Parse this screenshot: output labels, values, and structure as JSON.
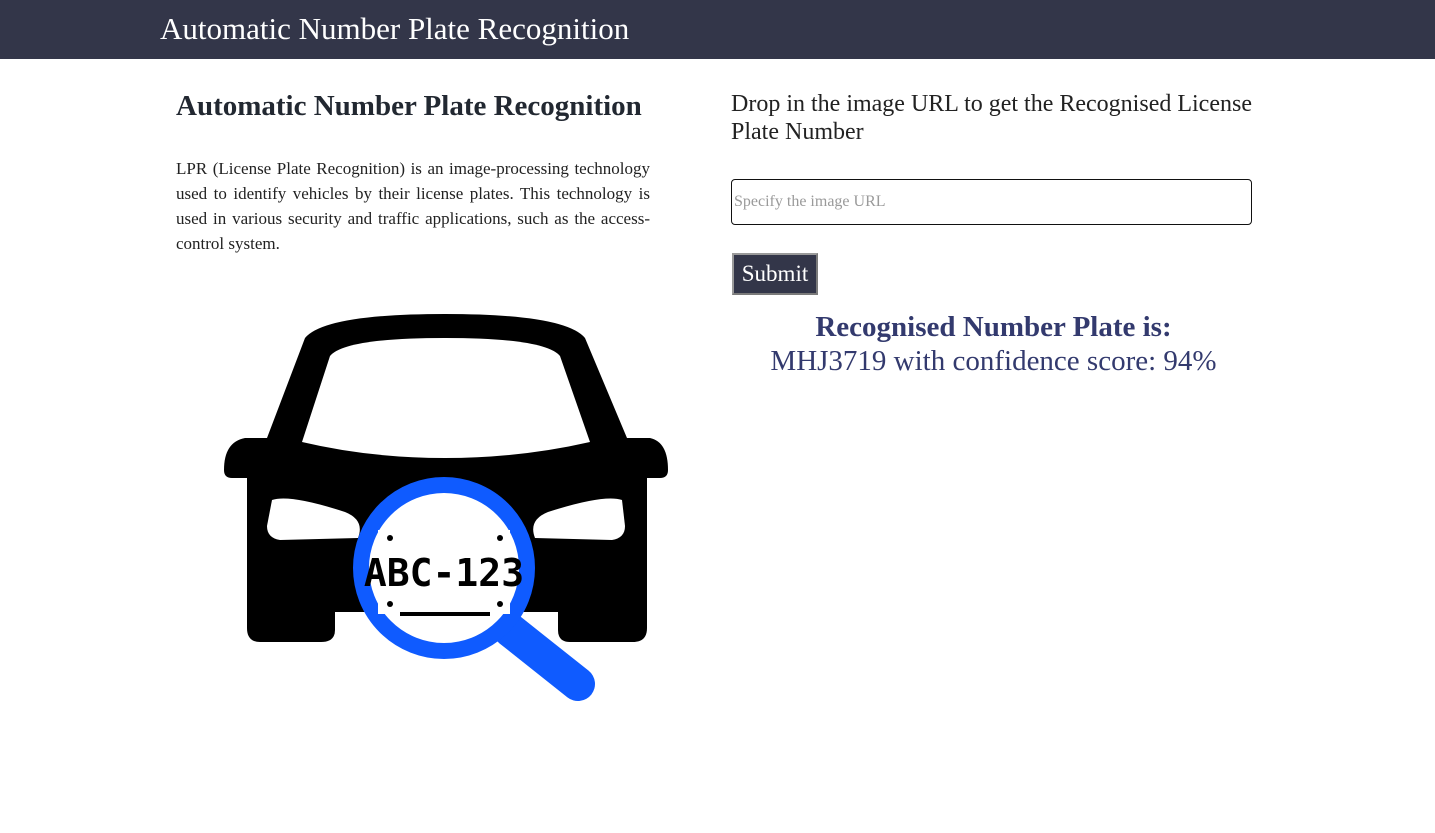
{
  "header": {
    "title": "Automatic Number Plate Recognition"
  },
  "intro": {
    "heading": "Automatic Number Plate Recognition",
    "description": "LPR (License Plate Recognition) is an image-processing technology used to identify vehicles by their license plates. This technology is used in various security and traffic applications, such as the access-control system."
  },
  "illustration": {
    "plate_text": "ABC-123",
    "icon": "car-with-magnifier-icon",
    "colors": {
      "car": "#000000",
      "magnifier": "#0f5bff"
    }
  },
  "form": {
    "prompt": "Drop in the image URL to get the Recognised License Plate Number",
    "url_value": "",
    "url_placeholder": "Specify the image URL",
    "submit_label": "Submit"
  },
  "result": {
    "title": "Recognised Number Plate is:",
    "value": "MHJ3719 with confidence score: 94%"
  },
  "colors": {
    "header_bg": "#333649",
    "result_text": "#333a6e"
  }
}
